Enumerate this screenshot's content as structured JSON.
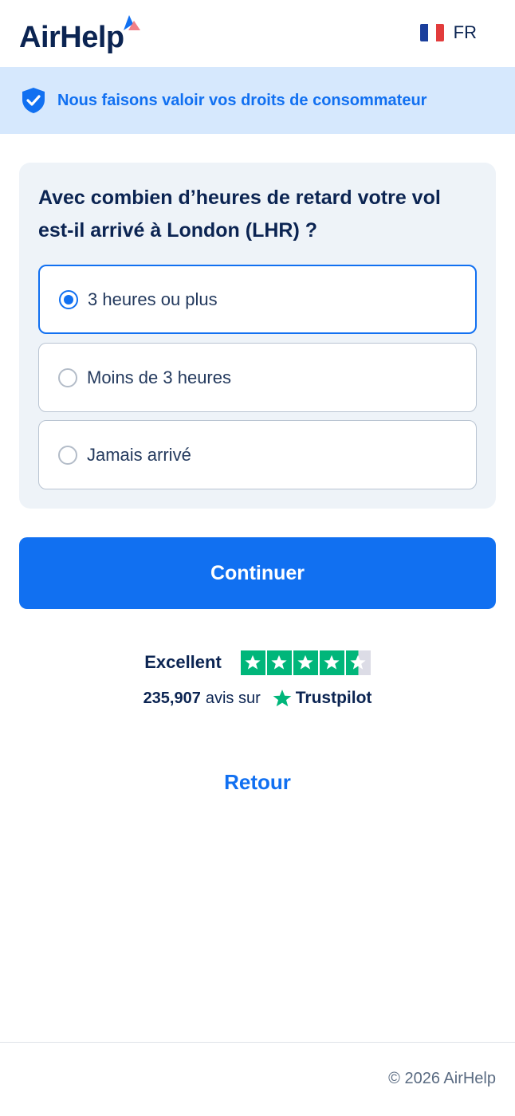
{
  "header": {
    "logo_text": "AirHelp",
    "language": "FR",
    "flag_colors": [
      "#1b3f9c",
      "#ffffff",
      "#e23c3c"
    ]
  },
  "banner": {
    "icon": "shield-check-icon",
    "text": "Nous faisons valoir vos droits de consommateur"
  },
  "question": {
    "text": "Avec combien d’heures de retard votre vol est-il arrivé à London (LHR) ?",
    "options": [
      {
        "label": "3 heures ou plus",
        "selected": true
      },
      {
        "label": "Moins de 3 heures",
        "selected": false
      },
      {
        "label": "Jamais arrivé",
        "selected": false
      }
    ]
  },
  "actions": {
    "continue_label": "Continuer",
    "back_label": "Retour"
  },
  "trustpilot": {
    "rating_label": "Excellent",
    "stars": 4.5,
    "review_count": "235,907",
    "reviews_on": "avis sur",
    "brand": "Trustpilot"
  },
  "footer": {
    "copyright": "© 2026 AirHelp"
  },
  "colors": {
    "brand_blue": "#1170f1",
    "navy": "#0b2452",
    "trustpilot_green": "#00b67a"
  }
}
